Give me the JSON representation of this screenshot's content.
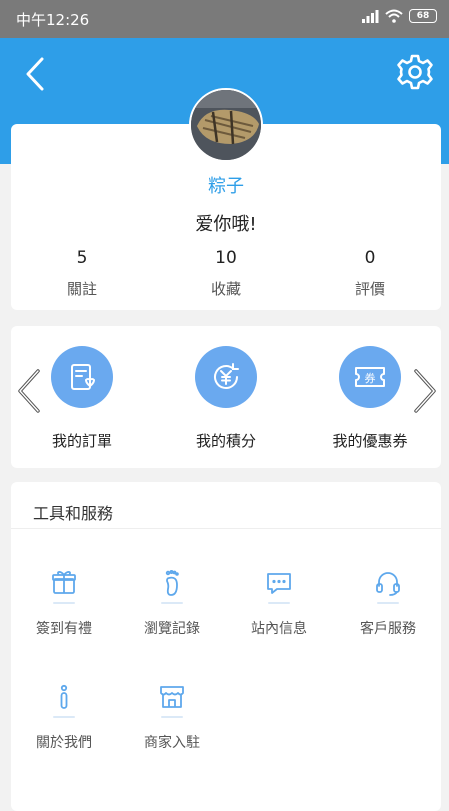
{
  "status_bar": {
    "time": "中午12:26",
    "battery": "68"
  },
  "header": {
    "back_icon": "chevron-left-icon",
    "settings_icon": "gear-icon"
  },
  "profile": {
    "username": "粽子",
    "signature": "爱你哦!",
    "stats": [
      {
        "value": "5",
        "label": "關註"
      },
      {
        "value": "10",
        "label": "收藏"
      },
      {
        "value": "0",
        "label": "評價"
      }
    ]
  },
  "shortcuts": [
    {
      "label": "我的訂單",
      "icon": "order-icon"
    },
    {
      "label": "我的積分",
      "icon": "points-icon"
    },
    {
      "label": "我的優惠券",
      "icon": "coupon-icon",
      "icon_text": "券"
    }
  ],
  "tools": {
    "title": "工具和服務",
    "items": [
      {
        "label": "簽到有禮",
        "icon": "gift-icon"
      },
      {
        "label": "瀏覽記錄",
        "icon": "footprint-icon"
      },
      {
        "label": "站內信息",
        "icon": "message-icon"
      },
      {
        "label": "客戶服務",
        "icon": "headset-icon"
      },
      {
        "label": "關於我們",
        "icon": "info-icon"
      },
      {
        "label": "商家入駐",
        "icon": "store-icon"
      }
    ]
  },
  "colors": {
    "primary": "#2e9ee8",
    "shortcut_circle": "#6aa9ef",
    "tool_icon": "#5ea8ec"
  }
}
